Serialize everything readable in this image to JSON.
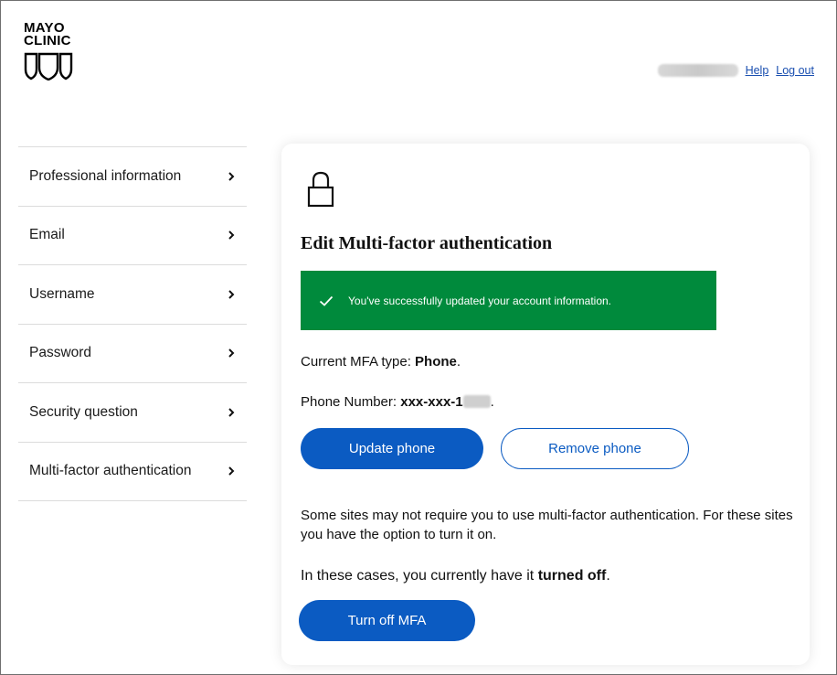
{
  "brand": {
    "logo_line1": "MAYO",
    "logo_line2": "CLINIC"
  },
  "header": {
    "help_label": "Help",
    "logout_label": "Log out"
  },
  "sidebar": {
    "items": [
      {
        "label": "Professional information"
      },
      {
        "label": "Email"
      },
      {
        "label": "Username"
      },
      {
        "label": "Password"
      },
      {
        "label": "Security question"
      },
      {
        "label": "Multi-factor authentication"
      }
    ]
  },
  "card": {
    "title": "Edit Multi-factor authentication",
    "success_message": "You've successfully updated your account information.",
    "mfa_type_prefix": "Current MFA type: ",
    "mfa_type_value": "Phone",
    "mfa_type_suffix": ".",
    "phone_prefix": "Phone Number: ",
    "phone_value": "xxx-xxx-1",
    "phone_suffix": ".",
    "update_phone_label": "Update phone",
    "remove_phone_label": "Remove phone",
    "info_text": "Some sites may not require you to use multi-factor authentication. For these sites you have the option to turn it on.",
    "status_prefix": "In these cases, you currently have it ",
    "status_value": "turned off",
    "status_suffix": ".",
    "turn_off_label": "Turn off MFA"
  },
  "colors": {
    "primary": "#0b5bc2",
    "success": "#008a3c",
    "link": "#1a4fb0"
  },
  "icons": {
    "lock": "lock-icon",
    "check": "check-icon",
    "chevron": "chevron-right-icon",
    "shield": "mayo-shield-logo"
  }
}
